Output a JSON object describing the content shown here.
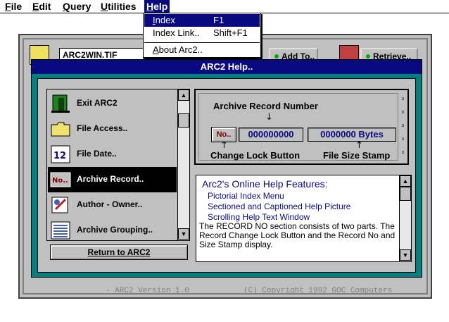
{
  "menubar": {
    "items": [
      {
        "mn": "F",
        "rest": "ile"
      },
      {
        "mn": "E",
        "rest": "dit"
      },
      {
        "mn": "Q",
        "rest": "uery"
      },
      {
        "mn": "U",
        "rest": "tilities"
      },
      {
        "mn": "H",
        "rest": "elp"
      }
    ]
  },
  "help_menu": {
    "items": [
      {
        "mn": "I",
        "rest": "ndex",
        "shortcut": "F1"
      },
      {
        "mn": "",
        "rest": "Index Link..",
        "shortcut": "Shift+F1"
      },
      {
        "mn": "A",
        "rest": "bout Arc2..",
        "shortcut": ""
      }
    ]
  },
  "background_window": {
    "filename": "ARC2WIN.TIF",
    "add_button": "Add To..",
    "retrieve_button": "Retrieve..",
    "status_version": "- ARC2  Version 1.0",
    "status_copyright": "(C) Copyright 1992 GOC Computers"
  },
  "help_dialog": {
    "title": "ARC2 Help..",
    "topics": [
      {
        "label": "Exit ARC2",
        "icon": "exit-door-icon"
      },
      {
        "label": "File Access..",
        "icon": "folder-icon"
      },
      {
        "label": "File Date..",
        "icon": "calendar-date-icon"
      },
      {
        "label": "Archive Record..",
        "icon": "record-no-icon",
        "selected": true
      },
      {
        "label": "Author - Owner..",
        "icon": "author-icon"
      },
      {
        "label": "Archive Grouping..",
        "icon": "grouping-list-icon"
      }
    ],
    "return_button": "Return to ARC2",
    "picture": {
      "heading": "Archive Record Number",
      "no_button": "No..",
      "record_number": "000000000",
      "size_stamp": "0000000 Bytes",
      "change_lock_caption": "Change Lock Button",
      "file_size_caption": "File Size Stamp"
    },
    "text": {
      "title": "Arc2's Online Help Features:",
      "links": [
        "Pictorial Index Menu",
        "Sectioned and Captioned Help Picture",
        "Scrolling Help Text Window"
      ],
      "body": "The RECORD NO section consists of two parts. The Record Change Lock Button and the Record No and Size Stamp display."
    }
  },
  "colors": {
    "title_bar": "#0a0a80",
    "dialog_frame": "#008080",
    "face": "#c0c0c0",
    "link_text": "#0a0a80"
  }
}
